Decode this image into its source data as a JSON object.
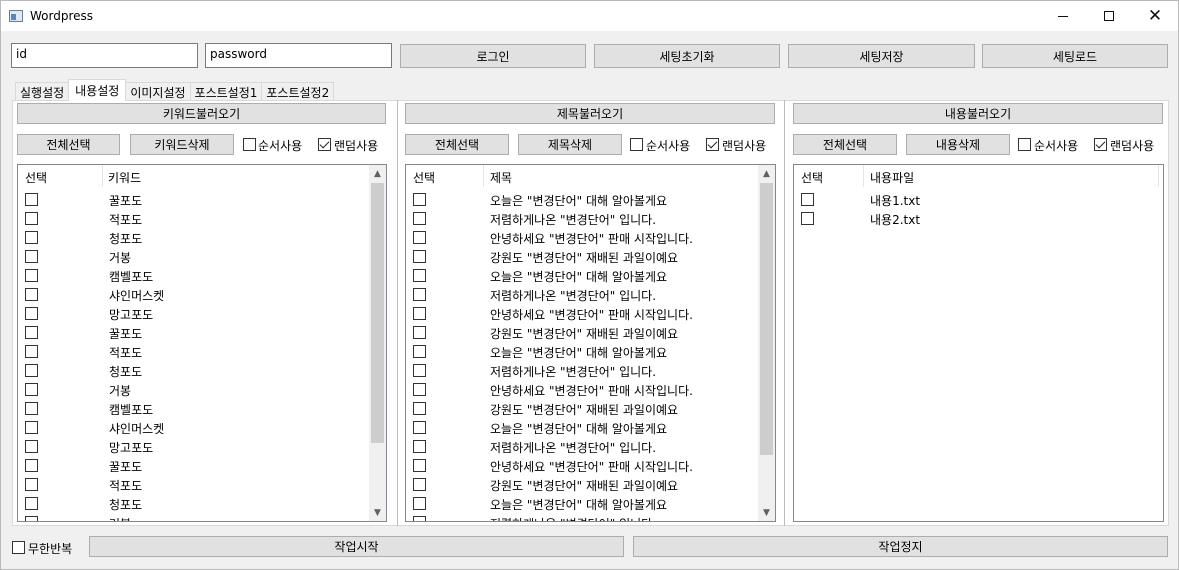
{
  "window": {
    "title": "Wordpress",
    "minimize_icon": "minimize-icon",
    "maximize_icon": "maximize-icon",
    "close_icon": "close-icon"
  },
  "login": {
    "id_value": "id",
    "password_value": "password",
    "login_label": "로그인",
    "reset_label": "세팅초기화",
    "save_label": "세팅저장",
    "load_label": "세팅로드"
  },
  "tabs": [
    {
      "label": "실행설정",
      "active": false
    },
    {
      "label": "내용설정",
      "active": true
    },
    {
      "label": "이미지설정",
      "active": false
    },
    {
      "label": "포스트설정1",
      "active": false
    },
    {
      "label": "포스트설정2",
      "active": false
    }
  ],
  "keyword_panel": {
    "load_label": "키워드불러오기",
    "select_all_label": "전체선택",
    "delete_label": "키워드삭제",
    "order_label": "순서사용",
    "order_checked": false,
    "random_label": "랜덤사용",
    "random_checked": true,
    "columns": [
      "선택",
      "키워드"
    ],
    "rows": [
      "꿀포도",
      "적포도",
      "청포도",
      "거봉",
      "캠벨포도",
      "샤인머스켓",
      "망고포도",
      "꿀포도",
      "적포도",
      "청포도",
      "거봉",
      "캠벨포도",
      "샤인머스켓",
      "망고포도",
      "꿀포도",
      "적포도",
      "청포도",
      "거봉"
    ]
  },
  "title_panel": {
    "load_label": "제목불러오기",
    "select_all_label": "전체선택",
    "delete_label": "제목삭제",
    "order_label": "순서사용",
    "order_checked": false,
    "random_label": "랜덤사용",
    "random_checked": true,
    "columns": [
      "선택",
      "제목"
    ],
    "rows": [
      "오늘은 \"변경단어\" 대해 알아볼게요",
      "저렴하게나온 \"변경단어\" 입니다.",
      "안녕하세요 \"변경단어\" 판매 시작입니다.",
      "강원도 \"변경단어\" 재배된 과일이예요",
      "오늘은 \"변경단어\" 대해 알아볼게요",
      "저렴하게나온 \"변경단어\" 입니다.",
      "안녕하세요 \"변경단어\" 판매 시작입니다.",
      "강원도 \"변경단어\" 재배된 과일이예요",
      "오늘은 \"변경단어\" 대해 알아볼게요",
      "저렴하게나온 \"변경단어\" 입니다.",
      "안녕하세요 \"변경단어\" 판매 시작입니다.",
      "강원도 \"변경단어\" 재배된 과일이예요",
      "오늘은 \"변경단어\" 대해 알아볼게요",
      "저렴하게나온 \"변경단어\" 입니다.",
      "안녕하세요 \"변경단어\" 판매 시작입니다.",
      "강원도 \"변경단어\" 재배된 과일이예요",
      "오늘은 \"변경단어\" 대해 알아볼게요",
      "저렴하게나온 \"변경단어\" 입니다."
    ]
  },
  "content_panel": {
    "load_label": "내용불러오기",
    "select_all_label": "전체선택",
    "delete_label": "내용삭제",
    "order_label": "순서사용",
    "order_checked": false,
    "random_label": "랜덤사용",
    "random_checked": true,
    "columns": [
      "선택",
      "내용파일"
    ],
    "rows": [
      "내용1.txt",
      "내용2.txt"
    ]
  },
  "footer": {
    "infinite_label": "무한반복",
    "infinite_checked": false,
    "start_label": "작업시작",
    "stop_label": "작업정지"
  }
}
